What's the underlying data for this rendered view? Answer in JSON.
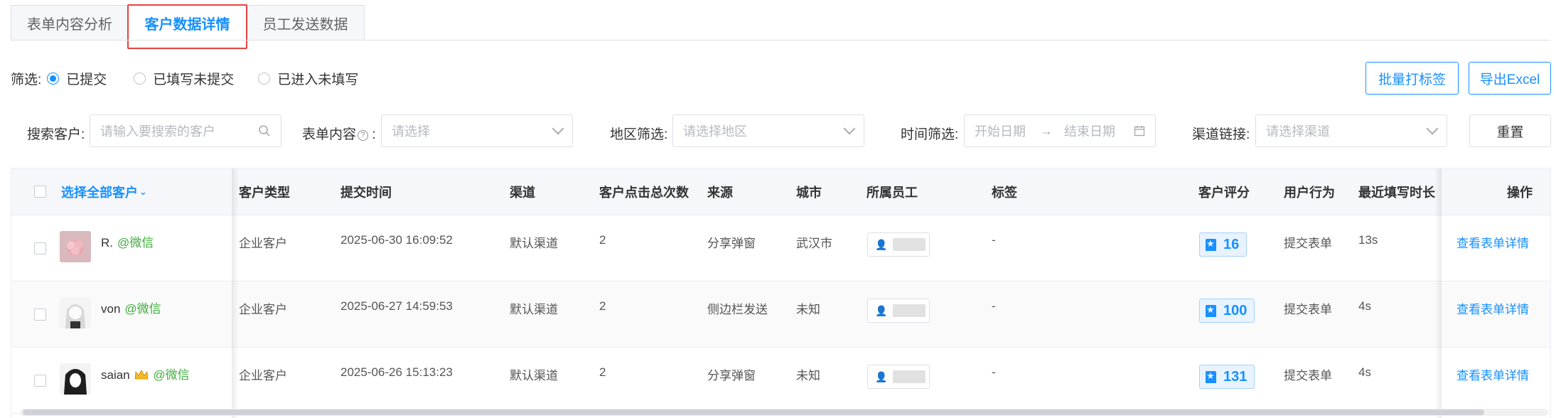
{
  "tabs": [
    {
      "label": "表单内容分析"
    },
    {
      "label": "客户数据详情"
    },
    {
      "label": "员工发送数据"
    }
  ],
  "filter": {
    "label": "筛选:",
    "options": [
      "已提交",
      "已填写未提交",
      "已进入未填写"
    ],
    "selected": "已提交"
  },
  "actions": {
    "batch_tag": "批量打标签",
    "export": "导出Excel",
    "reset": "重置"
  },
  "search": {
    "customer_label": "搜索客户:",
    "customer_placeholder": "请输入要搜索的客户",
    "form_content_label": "表单内容",
    "form_content_placeholder": "请选择",
    "region_label": "地区筛选:",
    "region_placeholder": "请选择地区",
    "time_label": "时间筛选:",
    "start_placeholder": "开始日期",
    "end_placeholder": "结束日期",
    "channel_label": "渠道链接:",
    "channel_placeholder": "请选择渠道"
  },
  "table": {
    "headers": {
      "select_all": "选择全部客户",
      "type": "客户类型",
      "submit_time": "提交时间",
      "channel": "渠道",
      "clicks": "客户点击总次数",
      "source": "来源",
      "city": "城市",
      "staff": "所属员工",
      "tags": "标签",
      "score": "客户评分",
      "behavior": "用户行为",
      "duration": "最近填写时长",
      "ops": "操作"
    },
    "rows": [
      {
        "name": "R.",
        "wechat": "@微信",
        "type": "企业客户",
        "submit_time": "2025-06-30 16:09:52",
        "channel": "默认渠道",
        "clicks": "2",
        "source": "分享弹窗",
        "city": "武汉市",
        "tag": "-",
        "score": "16",
        "behavior": "提交表单",
        "duration": "13s",
        "op": "查看表单详情"
      },
      {
        "name": "von",
        "wechat": "@微信",
        "type": "企业客户",
        "submit_time": "2025-06-27 14:59:53",
        "channel": "默认渠道",
        "clicks": "2",
        "source": "侧边栏发送",
        "city": "未知",
        "tag": "-",
        "score": "100",
        "behavior": "提交表单",
        "duration": "4s",
        "op": "查看表单详情"
      },
      {
        "name": "saian",
        "wechat": "@微信",
        "type": "企业客户",
        "submit_time": "2025-06-26 15:13:23",
        "channel": "默认渠道",
        "clicks": "2",
        "source": "分享弹窗",
        "city": "未知",
        "tag": "-",
        "score": "131",
        "behavior": "提交表单",
        "duration": "4s",
        "op": "查看表单详情"
      }
    ]
  },
  "colors": {
    "accent": "#1890ff",
    "highlight_border": "#e5433f",
    "wechat_green": "#3dae3d"
  }
}
